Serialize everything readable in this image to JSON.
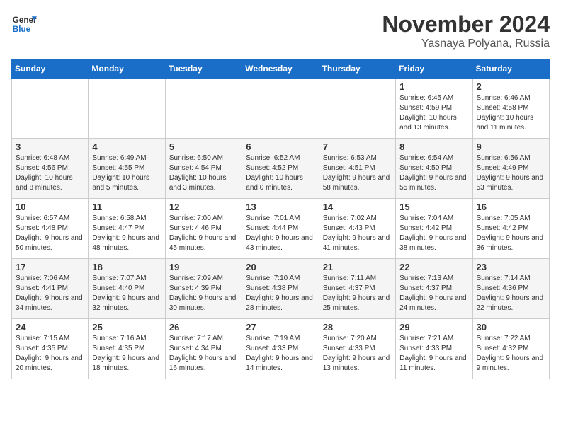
{
  "header": {
    "logo_general": "General",
    "logo_blue": "Blue",
    "month_title": "November 2024",
    "location": "Yasnaya Polyana, Russia"
  },
  "weekdays": [
    "Sunday",
    "Monday",
    "Tuesday",
    "Wednesday",
    "Thursday",
    "Friday",
    "Saturday"
  ],
  "weeks": [
    [
      {
        "day": "",
        "text": ""
      },
      {
        "day": "",
        "text": ""
      },
      {
        "day": "",
        "text": ""
      },
      {
        "day": "",
        "text": ""
      },
      {
        "day": "",
        "text": ""
      },
      {
        "day": "1",
        "text": "Sunrise: 6:45 AM\nSunset: 4:59 PM\nDaylight: 10 hours and 13 minutes."
      },
      {
        "day": "2",
        "text": "Sunrise: 6:46 AM\nSunset: 4:58 PM\nDaylight: 10 hours and 11 minutes."
      }
    ],
    [
      {
        "day": "3",
        "text": "Sunrise: 6:48 AM\nSunset: 4:56 PM\nDaylight: 10 hours and 8 minutes."
      },
      {
        "day": "4",
        "text": "Sunrise: 6:49 AM\nSunset: 4:55 PM\nDaylight: 10 hours and 5 minutes."
      },
      {
        "day": "5",
        "text": "Sunrise: 6:50 AM\nSunset: 4:54 PM\nDaylight: 10 hours and 3 minutes."
      },
      {
        "day": "6",
        "text": "Sunrise: 6:52 AM\nSunset: 4:52 PM\nDaylight: 10 hours and 0 minutes."
      },
      {
        "day": "7",
        "text": "Sunrise: 6:53 AM\nSunset: 4:51 PM\nDaylight: 9 hours and 58 minutes."
      },
      {
        "day": "8",
        "text": "Sunrise: 6:54 AM\nSunset: 4:50 PM\nDaylight: 9 hours and 55 minutes."
      },
      {
        "day": "9",
        "text": "Sunrise: 6:56 AM\nSunset: 4:49 PM\nDaylight: 9 hours and 53 minutes."
      }
    ],
    [
      {
        "day": "10",
        "text": "Sunrise: 6:57 AM\nSunset: 4:48 PM\nDaylight: 9 hours and 50 minutes."
      },
      {
        "day": "11",
        "text": "Sunrise: 6:58 AM\nSunset: 4:47 PM\nDaylight: 9 hours and 48 minutes."
      },
      {
        "day": "12",
        "text": "Sunrise: 7:00 AM\nSunset: 4:46 PM\nDaylight: 9 hours and 45 minutes."
      },
      {
        "day": "13",
        "text": "Sunrise: 7:01 AM\nSunset: 4:44 PM\nDaylight: 9 hours and 43 minutes."
      },
      {
        "day": "14",
        "text": "Sunrise: 7:02 AM\nSunset: 4:43 PM\nDaylight: 9 hours and 41 minutes."
      },
      {
        "day": "15",
        "text": "Sunrise: 7:04 AM\nSunset: 4:42 PM\nDaylight: 9 hours and 38 minutes."
      },
      {
        "day": "16",
        "text": "Sunrise: 7:05 AM\nSunset: 4:42 PM\nDaylight: 9 hours and 36 minutes."
      }
    ],
    [
      {
        "day": "17",
        "text": "Sunrise: 7:06 AM\nSunset: 4:41 PM\nDaylight: 9 hours and 34 minutes."
      },
      {
        "day": "18",
        "text": "Sunrise: 7:07 AM\nSunset: 4:40 PM\nDaylight: 9 hours and 32 minutes."
      },
      {
        "day": "19",
        "text": "Sunrise: 7:09 AM\nSunset: 4:39 PM\nDaylight: 9 hours and 30 minutes."
      },
      {
        "day": "20",
        "text": "Sunrise: 7:10 AM\nSunset: 4:38 PM\nDaylight: 9 hours and 28 minutes."
      },
      {
        "day": "21",
        "text": "Sunrise: 7:11 AM\nSunset: 4:37 PM\nDaylight: 9 hours and 25 minutes."
      },
      {
        "day": "22",
        "text": "Sunrise: 7:13 AM\nSunset: 4:37 PM\nDaylight: 9 hours and 24 minutes."
      },
      {
        "day": "23",
        "text": "Sunrise: 7:14 AM\nSunset: 4:36 PM\nDaylight: 9 hours and 22 minutes."
      }
    ],
    [
      {
        "day": "24",
        "text": "Sunrise: 7:15 AM\nSunset: 4:35 PM\nDaylight: 9 hours and 20 minutes."
      },
      {
        "day": "25",
        "text": "Sunrise: 7:16 AM\nSunset: 4:35 PM\nDaylight: 9 hours and 18 minutes."
      },
      {
        "day": "26",
        "text": "Sunrise: 7:17 AM\nSunset: 4:34 PM\nDaylight: 9 hours and 16 minutes."
      },
      {
        "day": "27",
        "text": "Sunrise: 7:19 AM\nSunset: 4:33 PM\nDaylight: 9 hours and 14 minutes."
      },
      {
        "day": "28",
        "text": "Sunrise: 7:20 AM\nSunset: 4:33 PM\nDaylight: 9 hours and 13 minutes."
      },
      {
        "day": "29",
        "text": "Sunrise: 7:21 AM\nSunset: 4:33 PM\nDaylight: 9 hours and 11 minutes."
      },
      {
        "day": "30",
        "text": "Sunrise: 7:22 AM\nSunset: 4:32 PM\nDaylight: 9 hours and 9 minutes."
      }
    ]
  ]
}
